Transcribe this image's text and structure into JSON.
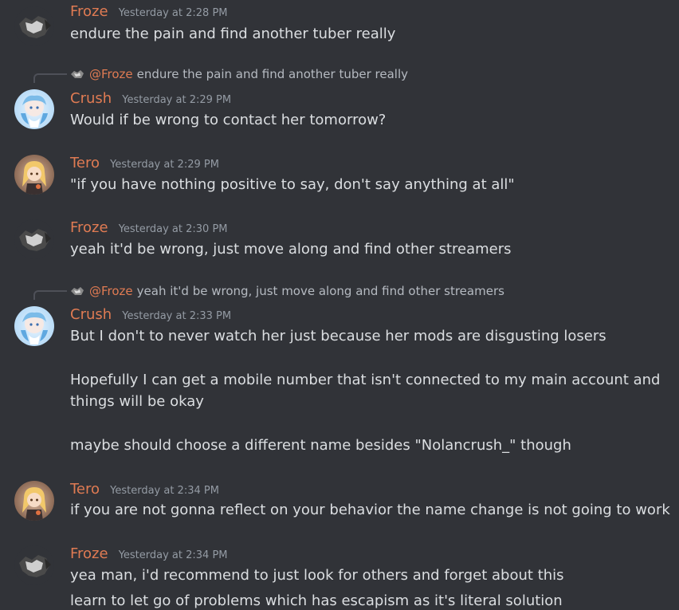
{
  "colors": {
    "background": "#313338",
    "username": "#e07b53",
    "text": "#dbdee1",
    "timestamp": "#949ba4"
  },
  "messages": [
    {
      "author": "Froze",
      "timestamp": "Yesterday at 2:28 PM",
      "avatar": "froze-avatar",
      "lines": [
        "endure the pain and find another tuber really"
      ]
    },
    {
      "reply": {
        "mention": "@Froze",
        "text": "endure the pain and find another tuber really"
      },
      "author": "Crush",
      "timestamp": "Yesterday at 2:29 PM",
      "avatar": "crush-avatar",
      "lines": [
        "Would if be wrong to contact her tomorrow?"
      ]
    },
    {
      "author": "Tero",
      "timestamp": "Yesterday at 2:29 PM",
      "avatar": "tero-avatar",
      "lines": [
        "\"if you have nothing positive to say, don't say anything at all\""
      ]
    },
    {
      "author": "Froze",
      "timestamp": "Yesterday at 2:30 PM",
      "avatar": "froze-avatar",
      "lines": [
        "yeah it'd be wrong, just move along and find other streamers"
      ]
    },
    {
      "reply": {
        "mention": "@Froze",
        "text": "yeah it'd be wrong, just move along and find other streamers"
      },
      "author": "Crush",
      "timestamp": "Yesterday at 2:33 PM",
      "avatar": "crush-avatar",
      "lines": [
        "But I don't to never watch her just because her mods are disgusting losers",
        "Hopefully I can get a mobile number that isn't connected to my main account and",
        "things will be okay",
        "maybe should choose a different name besides \"Nolancrush_\" though"
      ]
    },
    {
      "author": "Tero",
      "timestamp": "Yesterday at 2:34 PM",
      "avatar": "tero-avatar",
      "lines": [
        "if you are not gonna reflect on your behavior the name change is not going to work"
      ]
    },
    {
      "author": "Froze",
      "timestamp": "Yesterday at 2:34 PM",
      "avatar": "froze-avatar",
      "lines": [
        "yea man, i'd recommend to just look for others and forget about this",
        "learn to let go of problems which has escapism as it's literal solution"
      ]
    }
  ]
}
